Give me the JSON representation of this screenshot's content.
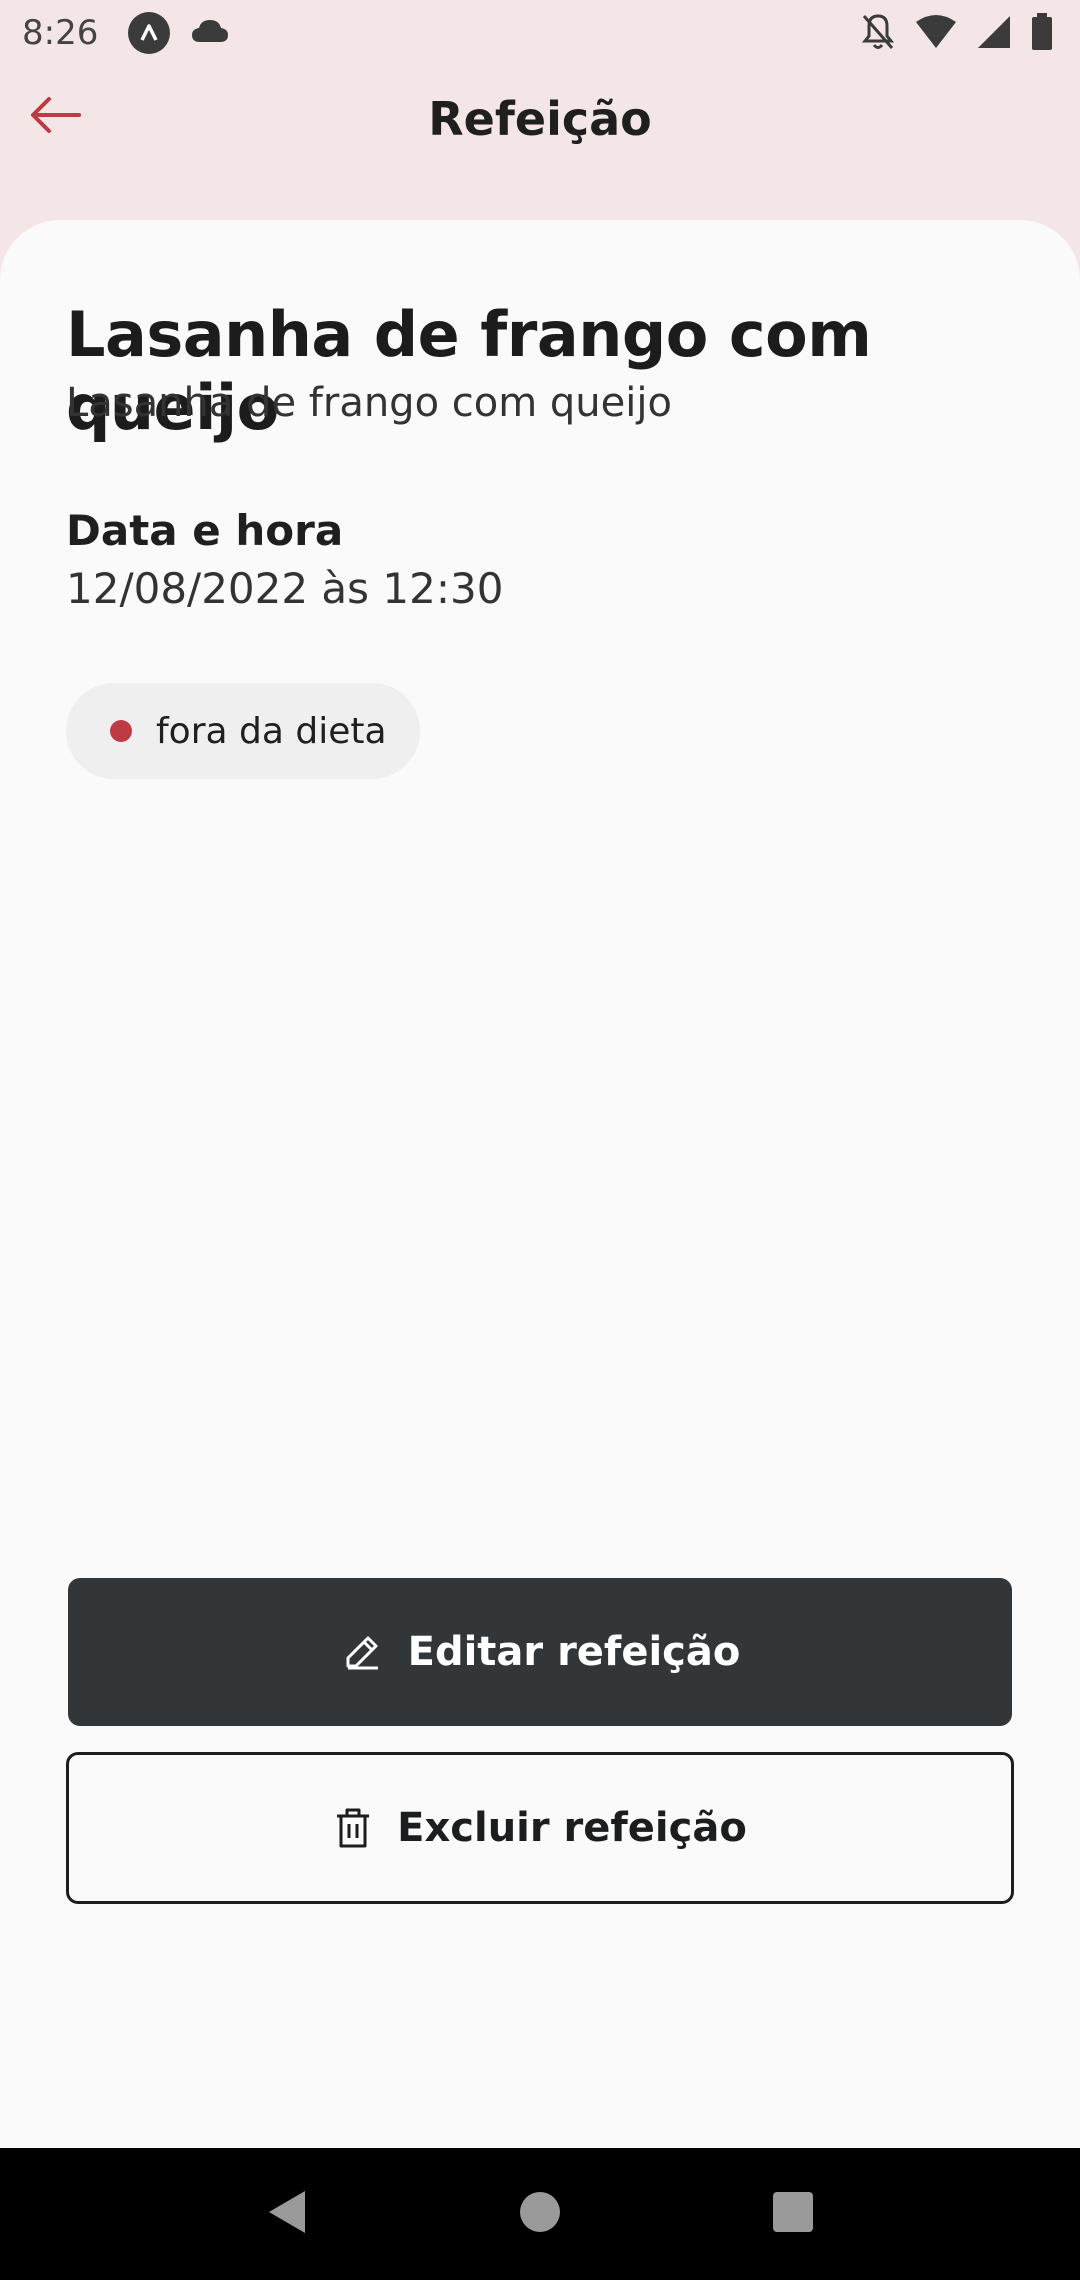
{
  "status_bar": {
    "time": "8:26",
    "icons": [
      "app-badge-icon",
      "cloud-icon",
      "notifications-off-icon",
      "wifi-icon",
      "signal-icon",
      "battery-icon"
    ]
  },
  "header": {
    "title": "Refeição",
    "back_icon": "arrow-left-icon"
  },
  "meal": {
    "name": "Lasanha de frango com queijo",
    "description": "Lasanha de frango com queijo",
    "datetime_label": "Data e hora",
    "datetime_value": "12/08/2022 às 12:30",
    "diet_status": "fora da dieta"
  },
  "actions": {
    "edit_label": "Editar refeição",
    "delete_label": "Excluir refeição"
  },
  "colors": {
    "header_bg": "#F4E6E7",
    "card_bg": "#FAFAFA",
    "accent_red": "#BF3B44",
    "button_dark": "#333638"
  },
  "nav": {
    "items": [
      "back-triangle-icon",
      "home-circle-icon",
      "recents-square-icon"
    ]
  }
}
